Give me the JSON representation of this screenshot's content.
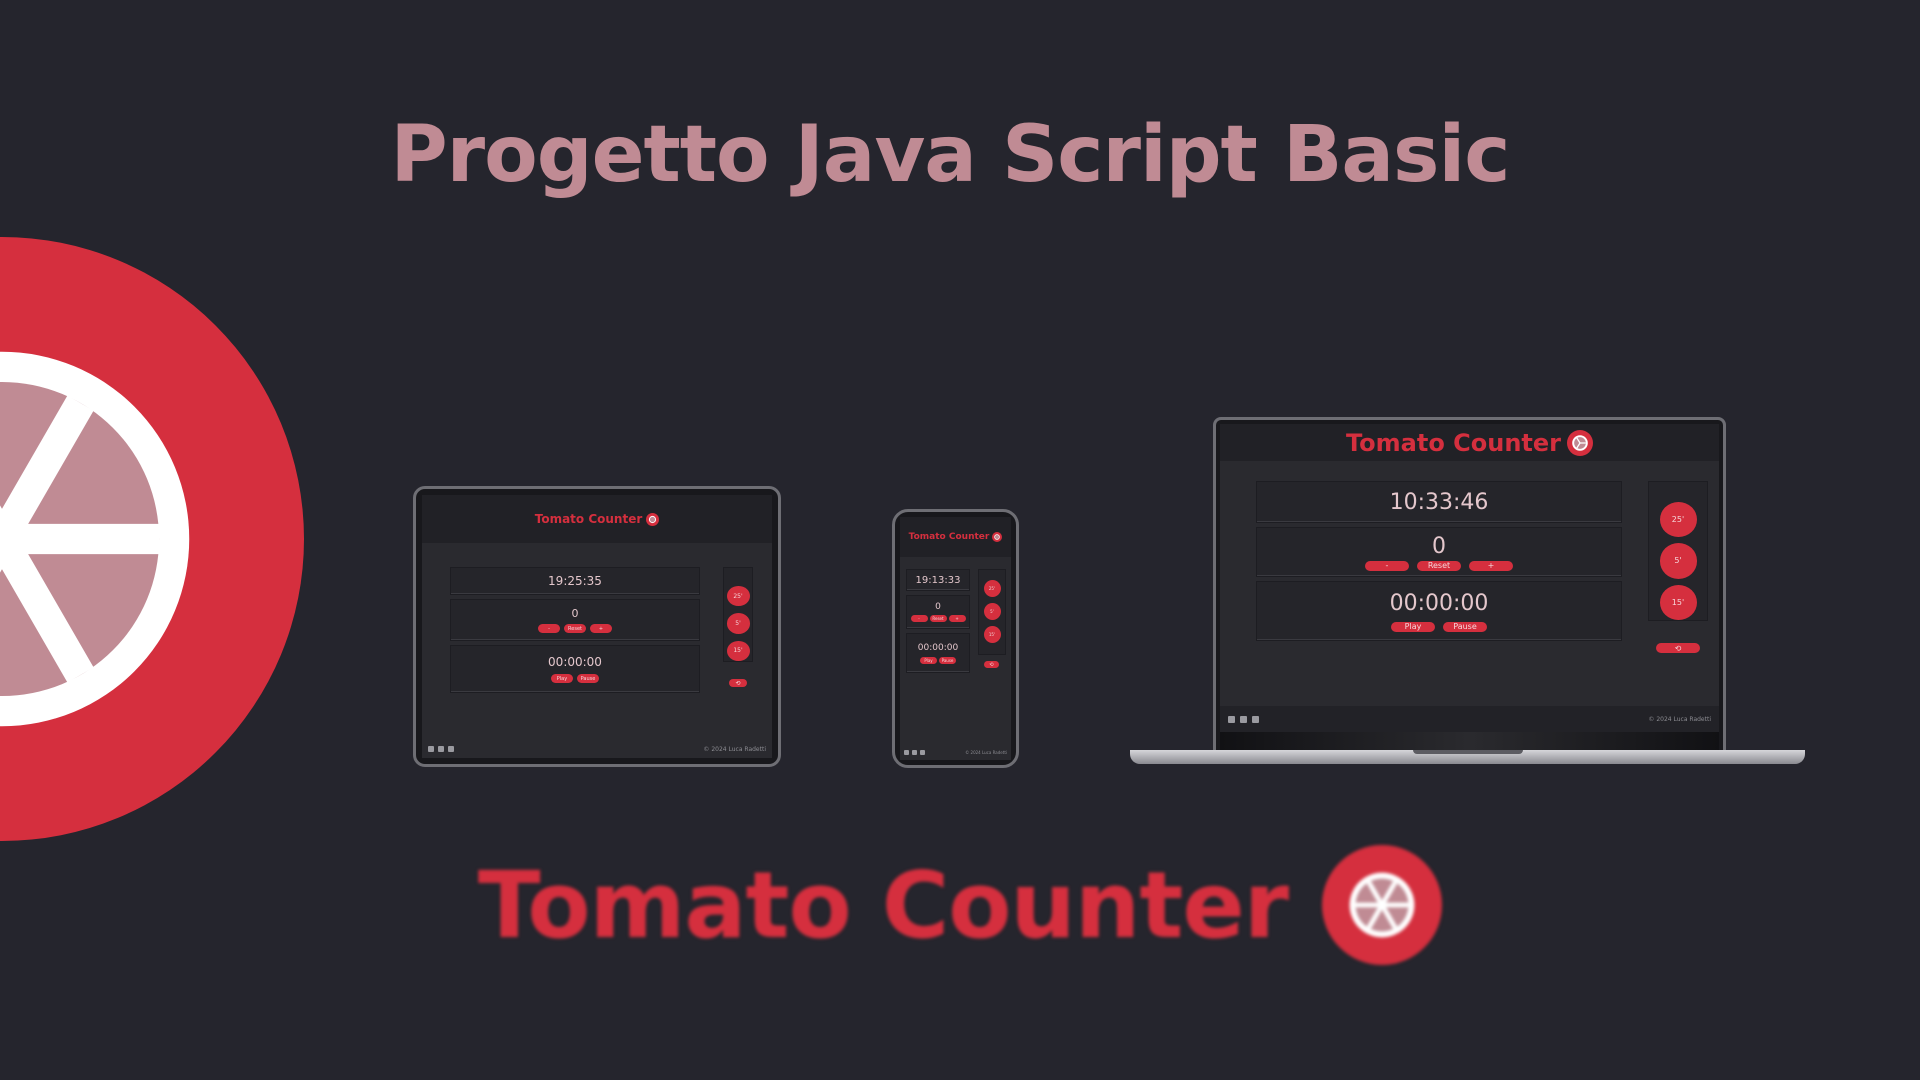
{
  "headline": "Progetto Java Script Basic",
  "brand": {
    "name": "Tomato Counter",
    "colors": {
      "background": "#25252d",
      "accent": "#d52f3e",
      "pink": "#c08b94"
    }
  },
  "app": {
    "title": "Tomato Counter",
    "logo_icon": "tomato-slice-icon",
    "counter_value": "0",
    "minus_label": "-",
    "reset_label": "Reset",
    "plus_label": "+",
    "play_label": "Play",
    "pause_label": "Pause",
    "preset_25": "25'",
    "preset_5": "5'",
    "preset_15": "15'",
    "clear_label": "⟲",
    "copyright": "© 2024 Luca Radetti",
    "social_icons": [
      "github-icon",
      "instagram-icon",
      "linkedin-icon"
    ]
  },
  "devices": {
    "tablet": {
      "clock": "19:25:35",
      "timer": "00:00:00"
    },
    "phone": {
      "clock": "19:13:33",
      "timer": "00:00:00"
    },
    "laptop": {
      "clock": "10:33:46",
      "timer": "00:00:00"
    }
  }
}
